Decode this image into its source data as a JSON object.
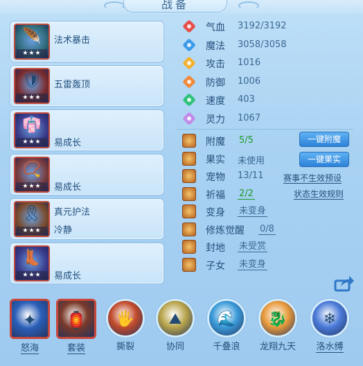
{
  "header": {
    "title": "战备"
  },
  "slots": [
    {
      "icon": "green-feather-icon",
      "glyph": "🪶",
      "bg": "#2e6a78",
      "stars": "★★★",
      "line1": "法术暴击",
      "line2": ""
    },
    {
      "icon": "armor-icon",
      "glyph": "🛡",
      "bg": "#7a2a2a",
      "stars": "★★★",
      "line1": "五雷轰顶",
      "line2": ""
    },
    {
      "icon": "robe-icon",
      "glyph": "👘",
      "bg": "#3a3a8a",
      "stars": "★★★",
      "line1": "",
      "line2": "易成长"
    },
    {
      "icon": "necklace-icon",
      "glyph": "📿",
      "bg": "#7a3a3a",
      "stars": "★★★",
      "line1": "",
      "line2": "易成长"
    },
    {
      "icon": "belt-icon",
      "glyph": "🎗",
      "bg": "#7a4a2a",
      "stars": "★★★",
      "line1": "真元护法",
      "line2": "冷静"
    },
    {
      "icon": "boots-icon",
      "glyph": "👢",
      "bg": "#3a3a8a",
      "stars": "★★★",
      "line1": "",
      "line2": "易成长"
    }
  ],
  "stats": [
    {
      "icon": "heart-icon",
      "color": "#e6504a",
      "label": "气血",
      "value": "3192/3192"
    },
    {
      "icon": "mana-icon",
      "color": "#3b9be8",
      "label": "魔法",
      "value": "3058/3058"
    },
    {
      "icon": "attack-icon",
      "color": "#f2b233",
      "label": "攻击",
      "value": "1016"
    },
    {
      "icon": "defense-icon",
      "color": "#f08a3a",
      "label": "防御",
      "value": "1006"
    },
    {
      "icon": "speed-icon",
      "color": "#2fc27a",
      "label": "速度",
      "value": "403"
    },
    {
      "icon": "spirit-icon",
      "color": "#c28ae8",
      "label": "灵力",
      "value": "1067"
    }
  ],
  "options": [
    {
      "icon": "enchant-icon",
      "label": "附魔",
      "value": "5/5",
      "style": "green"
    },
    {
      "icon": "fruit-icon",
      "label": "果实",
      "value": "未使用",
      "style": "plain"
    },
    {
      "icon": "pet-icon",
      "label": "宠物",
      "value": "13/11",
      "style": "plain"
    },
    {
      "icon": "blessing-icon",
      "label": "祈福",
      "value": "2/2",
      "style": "green-ul"
    },
    {
      "icon": "transform-icon",
      "label": "变身",
      "value": "未变身",
      "style": "ul"
    },
    {
      "icon": "awaken-icon",
      "label": "修炼觉醒",
      "value": "0/8",
      "style": "ul"
    },
    {
      "icon": "territory-icon",
      "label": "封地",
      "value": "未受赏",
      "style": "ul"
    },
    {
      "icon": "child-icon",
      "label": "子女",
      "value": "未变身",
      "style": "ul"
    }
  ],
  "buttons": {
    "enchant": "一键附魔",
    "fruit": "一键果实"
  },
  "links": {
    "preset": "赛事不生效预设",
    "rules": "状态生效规则"
  },
  "skills": [
    {
      "label": "怒海",
      "type": "square",
      "glyph": "✦",
      "bg": "#2a5fb8",
      "underline": true
    },
    {
      "label": "套装",
      "type": "square",
      "glyph": "🏮",
      "bg": "#7a3a2a",
      "underline": true
    },
    {
      "label": "撕裂",
      "type": "ring",
      "glyph": "🖐",
      "bg": "#c24a2a",
      "underline": false
    },
    {
      "label": "协同",
      "type": "ring",
      "glyph": "⛰",
      "bg": "#b8a44a",
      "underline": false
    },
    {
      "label": "千叠浪",
      "type": "ring",
      "glyph": "🌊",
      "bg": "#3a9ad8",
      "underline": false
    },
    {
      "label": "龙翔九天",
      "type": "ring",
      "glyph": "🐉",
      "bg": "#e89a3a",
      "underline": false
    },
    {
      "label": "洛水缚",
      "type": "ring",
      "glyph": "❄",
      "bg": "#4a7ad8",
      "underline": true
    }
  ]
}
